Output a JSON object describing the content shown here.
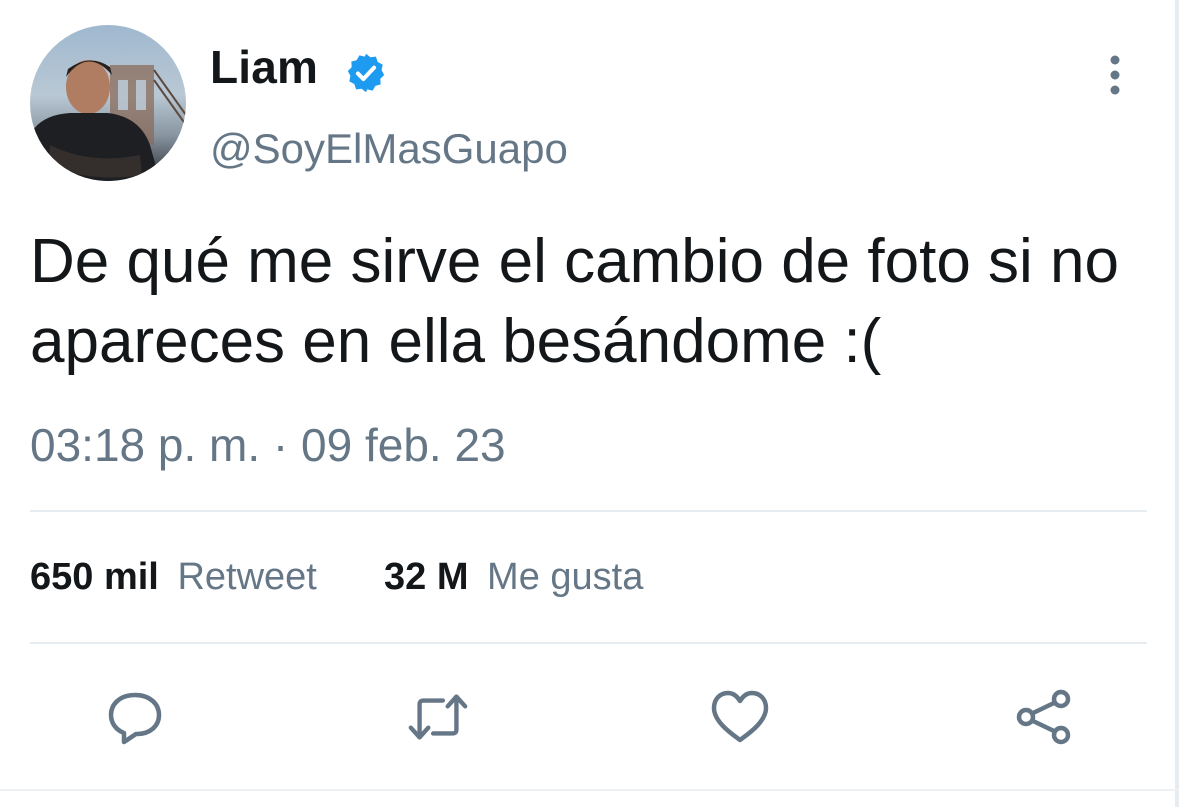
{
  "author": {
    "display_name": "Liam",
    "handle": "@SoyElMasGuapo",
    "verified": true
  },
  "tweet": {
    "text": "De qué me sirve el cambio de foto si no apareces en ella besándome :(",
    "timestamp": "03:18 p. m. · 09 feb. 23"
  },
  "stats": {
    "retweets_count": "650 mil",
    "retweets_label": "Retweet",
    "likes_count": "32 M",
    "likes_label": "Me gusta"
  },
  "actions": [
    {
      "icon": "reply-icon"
    },
    {
      "icon": "retweet-icon"
    },
    {
      "icon": "like-icon"
    },
    {
      "icon": "share-icon"
    }
  ],
  "colors": {
    "verified_blue": "#1d9bf0",
    "secondary_text": "#657786",
    "icon_gray": "#657786",
    "divider": "#e6ecf0"
  }
}
